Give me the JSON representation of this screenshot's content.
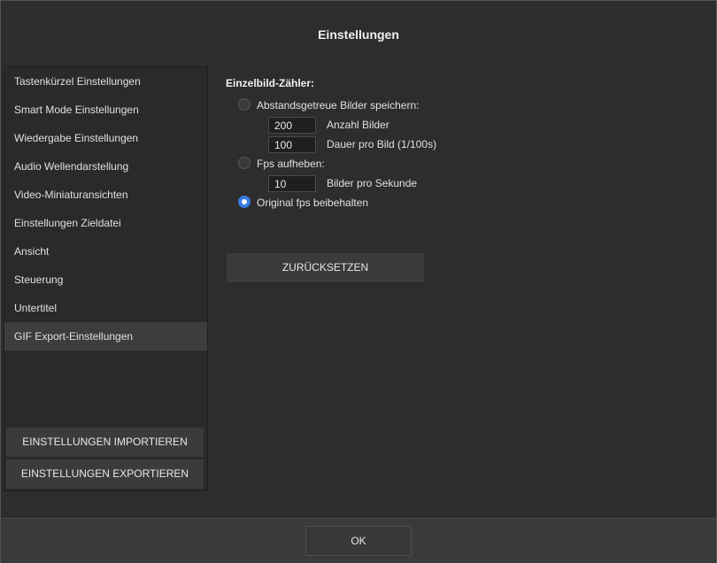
{
  "dialog": {
    "title": "Einstellungen"
  },
  "sidebar": {
    "items": [
      {
        "label": "Tastenkürzel Einstellungen"
      },
      {
        "label": "Smart Mode Einstellungen"
      },
      {
        "label": "Wiedergabe Einstellungen"
      },
      {
        "label": "Audio Wellendarstellung"
      },
      {
        "label": "Video-Miniaturansichten"
      },
      {
        "label": "Einstellungen Zieldatei"
      },
      {
        "label": "Ansicht"
      },
      {
        "label": "Steuerung"
      },
      {
        "label": "Untertitel"
      },
      {
        "label": "GIF Export-Einstellungen"
      }
    ],
    "active_item": "GIF Export-Einstellungen",
    "import_label": "EINSTELLUNGEN IMPORTIEREN",
    "export_label": "EINSTELLUNGEN EXPORTIEREN"
  },
  "gif": {
    "section_label": "Einzelbild-Zähler:",
    "option_equidistant": {
      "label": "Abstandsgetreue Bilder speichern:",
      "checked": false,
      "count_value": "200",
      "count_label": "Anzahl Bilder",
      "duration_value": "100",
      "duration_label": "Dauer pro Bild (1/100s)"
    },
    "option_fps": {
      "label": "Fps aufheben:",
      "checked": false,
      "fps_value": "10",
      "fps_label": "Bilder pro Sekunde"
    },
    "option_original": {
      "label": "Original fps beibehalten",
      "checked": true
    },
    "reset_label": "ZURÜCKSETZEN"
  },
  "footer": {
    "ok_label": "OK"
  },
  "colors": {
    "accent": "#3a7be0",
    "background": "#2d2d2d",
    "button": "#3b3b3b"
  }
}
